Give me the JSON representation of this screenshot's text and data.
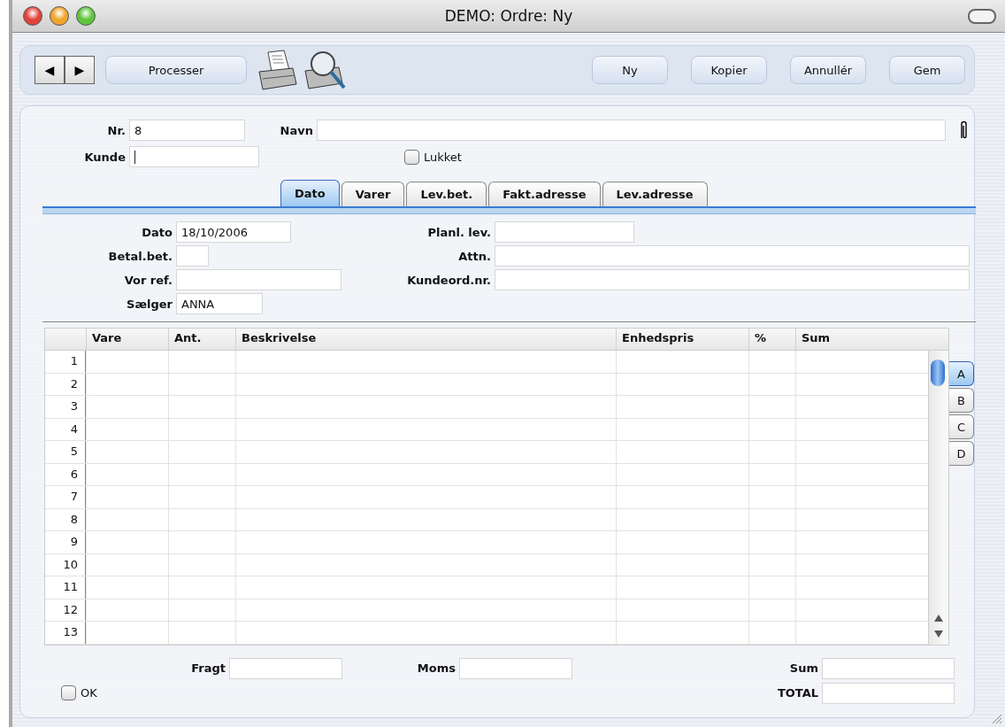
{
  "window": {
    "title": "DEMO: Ordre: Ny"
  },
  "toolbar": {
    "nav": [
      "◀",
      "▶"
    ],
    "process_button": "Processer",
    "buttons": [
      "Ny",
      "Kopier",
      "Annullér",
      "Gem"
    ]
  },
  "header": {
    "nr": {
      "label": "Nr.",
      "value": "8"
    },
    "navn": {
      "label": "Navn"
    },
    "kunde": {
      "label": "Kunde",
      "focused": true
    },
    "lukket": {
      "label": "Lukket",
      "checked": false
    }
  },
  "tabs": [
    {
      "label": "Dato",
      "selected": true
    },
    {
      "label": "Varer",
      "selected": false
    },
    {
      "label": "Lev.bet.",
      "selected": false
    },
    {
      "label": "Fakt.adresse",
      "selected": false
    },
    {
      "label": "Lev.adresse",
      "selected": false
    }
  ],
  "dato_section": {
    "left": [
      {
        "label": "Dato",
        "value": "18/10/2006"
      },
      {
        "label": "Betal.bet."
      },
      {
        "label": "Vor ref."
      },
      {
        "label": "Sælger",
        "value": "ANNA"
      }
    ],
    "right": [
      {
        "label": "Planl. lev."
      },
      {
        "label": "Attn."
      },
      {
        "label": "Kundeord.nr."
      }
    ]
  },
  "table": {
    "columns": [
      "Vare",
      "Ant.",
      "Beskrivelse",
      "Enhedspris",
      "%",
      "Sum"
    ],
    "rows": [
      "1",
      "2",
      "3",
      "4",
      "5",
      "6",
      "7",
      "8",
      "9",
      "10",
      "11",
      "12",
      "13"
    ]
  },
  "side_tabs": [
    {
      "label": "A",
      "selected": true
    },
    {
      "label": "B",
      "selected": false
    },
    {
      "label": "C",
      "selected": false
    },
    {
      "label": "D",
      "selected": false
    }
  ],
  "footer": {
    "fragt": {
      "label": "Fragt"
    },
    "moms": {
      "label": "Moms"
    },
    "sum": {
      "label": "Sum"
    },
    "total": {
      "label": "TOTAL"
    },
    "ok": {
      "label": "OK",
      "checked": false
    }
  }
}
